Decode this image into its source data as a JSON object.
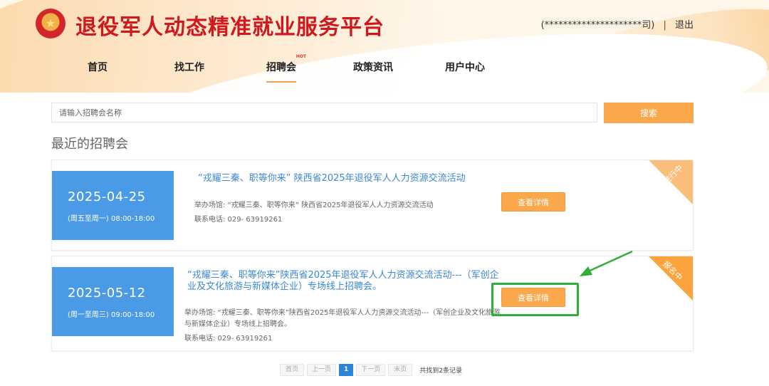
{
  "header": {
    "site_title": "退役军人动态精准就业服务平台",
    "user_name": "(*********************司)",
    "separator": "|",
    "logout_label": "退出"
  },
  "nav": {
    "items": [
      {
        "label": "首页"
      },
      {
        "label": "找工作"
      },
      {
        "label": "招聘会",
        "active": true,
        "badge": "HOT"
      },
      {
        "label": "政策资讯"
      },
      {
        "label": "用户中心"
      }
    ]
  },
  "search": {
    "placeholder": "请输入招聘会名称",
    "button_label": "搜索"
  },
  "section": {
    "title": "最近的招聘会"
  },
  "fairs": [
    {
      "date": "2025-04-25",
      "time": "(周五至周一) 08:00-18:00",
      "title": "“戎耀三秦、职等你来” 陕西省2025年退役军人人力资源交流活动",
      "venue": "举办场馆: “戎耀三秦、职等你来” 陕西省2025年退役军人人力资源交流活动",
      "phone": "联系电话: 029- 63919261",
      "button_label": "查看详情",
      "status": "进行中",
      "status_color": "#fbbd7a"
    },
    {
      "date": "2025-05-12",
      "time": "(周一至周三) 09:00-18:00",
      "title": "“戎耀三秦、职等你来”陕西省2025年退役军人人力资源交流活动---（军创企业及文化旅游与新媒体企业）专场线上招聘会。",
      "venue": "举办场馆: “戎耀三秦、职等你来”陕西省2025年退役军人人力资源交流活动---（军创企业及文化旅游与新媒体企业）专场线上招聘会。",
      "phone": "联系电话: 029- 63919261",
      "button_label": "查看详情",
      "status": "报名中",
      "status_color": "#fba33c"
    }
  ],
  "pagination": {
    "first": "首页",
    "prev": "上一页",
    "current": "1",
    "next": "下一页",
    "last": "末页",
    "total": "共找到2条记录"
  },
  "colors": {
    "accent": "#fba84d",
    "brand_red": "#d0191f",
    "date_blue": "#4a9ae6",
    "link_blue": "#3b87d6",
    "annotation_green": "#2fae3a"
  }
}
